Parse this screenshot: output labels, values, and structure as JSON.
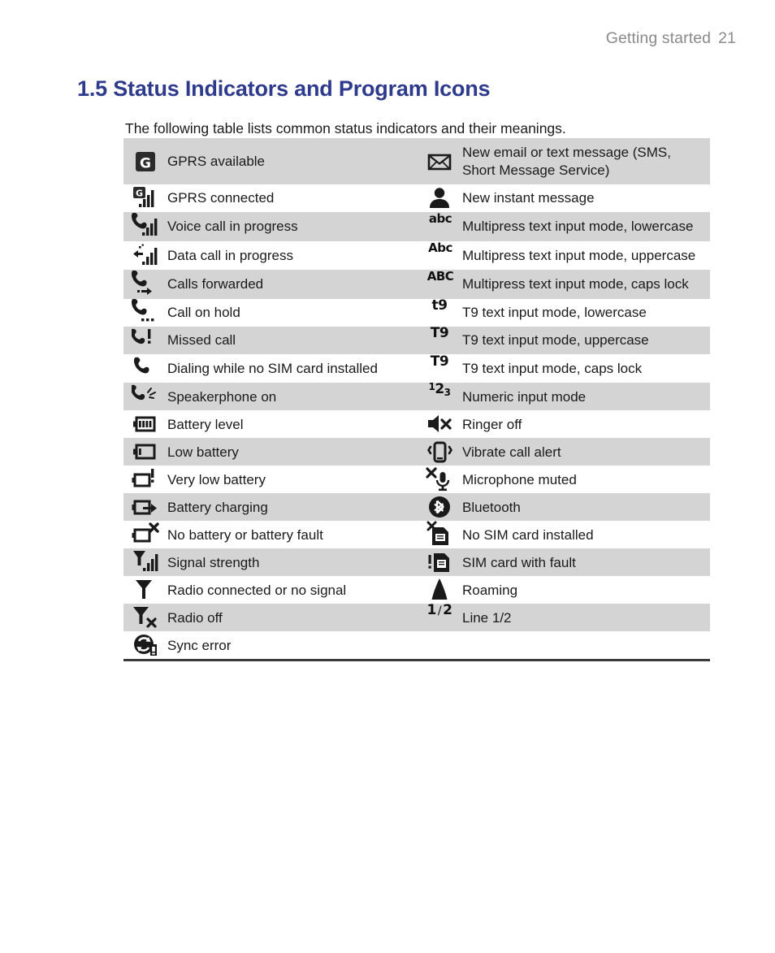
{
  "header": {
    "chapter": "Getting started",
    "page_number": "21"
  },
  "section": {
    "title": "1.5 Status Indicators and Program Icons",
    "intro": "The following table lists common status indicators and their meanings."
  },
  "table": {
    "rows": [
      {
        "shaded": true,
        "left": {
          "icon": "gprs-available-icon",
          "label": "GPRS available"
        },
        "right": {
          "icon": "envelope-icon",
          "label": "New email or text message (SMS, Short Message Service)"
        }
      },
      {
        "shaded": false,
        "left": {
          "icon": "gprs-connected-icon",
          "label": "GPRS connected"
        },
        "right": {
          "icon": "person-icon",
          "label": "New instant message"
        }
      },
      {
        "shaded": true,
        "left": {
          "icon": "voice-call-icon",
          "label": "Voice call in progress"
        },
        "right": {
          "icon": "abc-lowercase-icon",
          "label": "Multipress text input mode, lowercase"
        }
      },
      {
        "shaded": false,
        "left": {
          "icon": "data-call-icon",
          "label": "Data call in progress"
        },
        "right": {
          "icon": "abc-uppercase-icon",
          "label": "Multipress text input mode, uppercase"
        }
      },
      {
        "shaded": true,
        "left": {
          "icon": "calls-forwarded-icon",
          "label": "Calls forwarded"
        },
        "right": {
          "icon": "abc-capslock-icon",
          "label": "Multipress text input mode, caps lock"
        }
      },
      {
        "shaded": false,
        "left": {
          "icon": "call-on-hold-icon",
          "label": "Call on hold"
        },
        "right": {
          "icon": "t9-lowercase-icon",
          "label": "T9 text input mode, lowercase"
        }
      },
      {
        "shaded": true,
        "left": {
          "icon": "missed-call-icon",
          "label": "Missed call"
        },
        "right": {
          "icon": "t9-uppercase-icon",
          "label": "T9 text input mode, uppercase"
        }
      },
      {
        "shaded": false,
        "left": {
          "icon": "dialing-no-sim-icon",
          "label": "Dialing while no SIM card installed"
        },
        "right": {
          "icon": "t9-capslock-icon",
          "label": "T9 text input mode, caps lock"
        }
      },
      {
        "shaded": true,
        "left": {
          "icon": "speakerphone-icon",
          "label": "Speakerphone on"
        },
        "right": {
          "icon": "numeric-mode-icon",
          "label": "Numeric input mode"
        }
      },
      {
        "shaded": false,
        "left": {
          "icon": "battery-level-icon",
          "label": "Battery level"
        },
        "right": {
          "icon": "ringer-off-icon",
          "label": "Ringer off"
        }
      },
      {
        "shaded": true,
        "left": {
          "icon": "low-battery-icon",
          "label": "Low battery"
        },
        "right": {
          "icon": "vibrate-icon",
          "label": "Vibrate call alert"
        }
      },
      {
        "shaded": false,
        "left": {
          "icon": "very-low-battery-icon",
          "label": "Very low battery"
        },
        "right": {
          "icon": "microphone-muted-icon",
          "label": "Microphone muted"
        }
      },
      {
        "shaded": true,
        "left": {
          "icon": "battery-charging-icon",
          "label": "Battery charging"
        },
        "right": {
          "icon": "bluetooth-icon",
          "label": "Bluetooth"
        }
      },
      {
        "shaded": false,
        "left": {
          "icon": "battery-fault-icon",
          "label": "No battery or battery fault"
        },
        "right": {
          "icon": "no-sim-card-icon",
          "label": "No SIM card installed"
        }
      },
      {
        "shaded": true,
        "left": {
          "icon": "signal-strength-icon",
          "label": "Signal strength"
        },
        "right": {
          "icon": "sim-card-fault-icon",
          "label": "SIM card with fault"
        }
      },
      {
        "shaded": false,
        "left": {
          "icon": "radio-connected-icon",
          "label": "Radio connected or no signal"
        },
        "right": {
          "icon": "roaming-icon",
          "label": "Roaming"
        }
      },
      {
        "shaded": true,
        "left": {
          "icon": "radio-off-icon",
          "label": "Radio off"
        },
        "right": {
          "icon": "line-1-2-icon",
          "label": "Line 1/2"
        }
      },
      {
        "shaded": false,
        "left": {
          "icon": "sync-error-icon",
          "label": "Sync error"
        },
        "right": {
          "icon": "",
          "label": ""
        }
      }
    ]
  },
  "glyphs": {
    "abc_lower": "abc",
    "abc_upper": "Abc",
    "abc_caps": "ABC",
    "t9_lower": "t9",
    "t9_upper": "T9",
    "t9_caps": "T9",
    "numeric": "123",
    "line_1": "1",
    "line_sep": "/",
    "line_2": "2",
    "gprs_letter": "G"
  },
  "colors": {
    "title": "#2e3b8c",
    "header_text": "#8a8a8a",
    "row_shade": "#d4d4d4",
    "body_text": "#1a1a1a",
    "icon_dark": "#1a1a1a"
  }
}
